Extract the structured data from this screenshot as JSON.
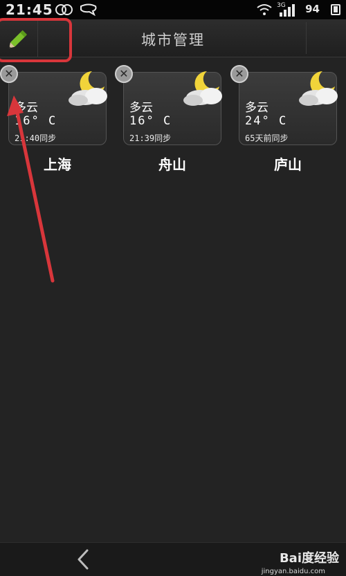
{
  "status_bar": {
    "time": "21:45",
    "network": "3G",
    "battery": "94",
    "icons": [
      "sync-rings-icon",
      "chat-bubble-icon",
      "wifi-icon",
      "signal-icon",
      "battery-icon"
    ]
  },
  "header": {
    "title": "城市管理",
    "edit_icon": "pencil-icon"
  },
  "cities": [
    {
      "condition": "多云",
      "temperature": "16° C",
      "sync": "21:40同步",
      "name": "上海",
      "weather_icon": "moon-cloud-icon"
    },
    {
      "condition": "多云",
      "temperature": "16° C",
      "sync": "21:39同步",
      "name": "舟山",
      "weather_icon": "moon-cloud-icon"
    },
    {
      "condition": "多云",
      "temperature": "24° C",
      "sync": "65天前同步",
      "name": "庐山",
      "weather_icon": "moon-cloud-icon"
    }
  ],
  "bottom_bar": {
    "back_icon": "chevron-left-icon",
    "watermark": "Bai度经验",
    "watermark_url": "jingyan.baidu.com"
  },
  "colors": {
    "background": "#232323",
    "highlight": "#d8363b",
    "pencil": "#7bbf2a"
  }
}
